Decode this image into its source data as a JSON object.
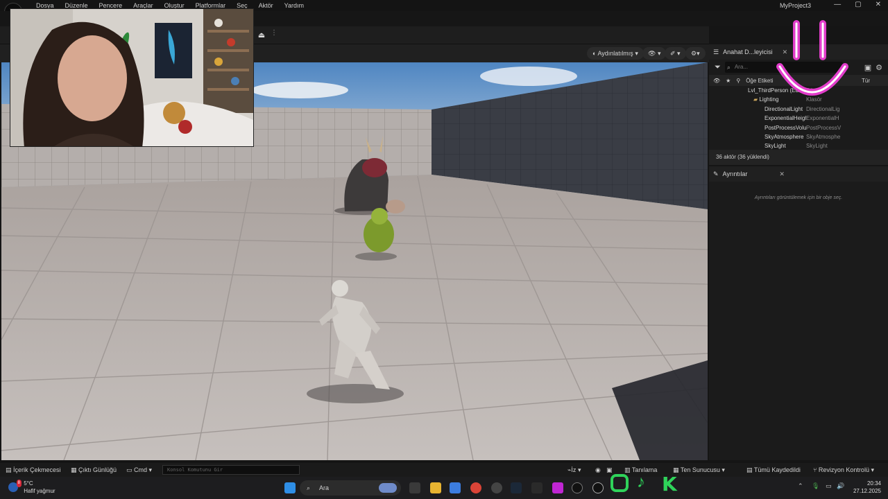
{
  "app": {
    "project_title": "MyProject3",
    "logo_text": "U",
    "window_controls": [
      "—",
      "▢",
      "✕"
    ]
  },
  "menu": [
    "Dosya",
    "Düzenle",
    "Pencere",
    "Araçlar",
    "Oluştur",
    "Platformlar",
    "Seç",
    "Aktör",
    "Yardım"
  ],
  "viewport": {
    "lit_mode_label": "Aydınlatılmış",
    "show_label": "👁",
    "mode_icon": "✐",
    "settings_icon": "⚙"
  },
  "outliner": {
    "tab_label": "Anahat D...leyicisi",
    "search_placeholder": "Ara...",
    "col_label": "Öğe Etiketi",
    "col_type": "Tür",
    "rows": [
      {
        "name": "Lvl_ThirdPerson (Editör)",
        "type": "Dünya"
      },
      {
        "name": "Lighting",
        "type": "Klasör"
      },
      {
        "name": "DirectionalLight",
        "type": "DirectionalLig"
      },
      {
        "name": "ExponentialHeightFog",
        "type": "ExponentialH"
      },
      {
        "name": "PostProcessVolume",
        "type": "PostProcessV"
      },
      {
        "name": "SkyAtmosphere",
        "type": "SkyAtmosphe"
      },
      {
        "name": "SkyLight",
        "type": "SkyLight"
      }
    ],
    "actor_count": "36 aktör (36 yüklendi)"
  },
  "details": {
    "tab_label": "Ayrıntılar",
    "empty_message": "Ayrıntıları görüntülemek için bir obje seç."
  },
  "statusbar": {
    "content_drawer": "İçerik Çekmecesi",
    "output_log": "Çıktı Günlüğü",
    "cmd": "Cmd",
    "console_placeholder": "Konsol Komutunu Gir",
    "trace": "İz",
    "derived_data": "Tanılama",
    "collab": "Ten Sunucusu",
    "save_all": "Tümü Kaydedildi",
    "revision_control": "Revizyon Kontrolü"
  },
  "taskbar": {
    "weather_temp": "5°C",
    "weather_desc": "Hafif yağmur",
    "search_label": "Ara",
    "time": "20:34",
    "date": "27.12.2025",
    "notification_badge": "8"
  },
  "colors": {
    "accent_pink": "#e23dcb",
    "sky_top": "#5e93cc",
    "floor": "#b9b3b1",
    "wall": "#3c3f47"
  }
}
